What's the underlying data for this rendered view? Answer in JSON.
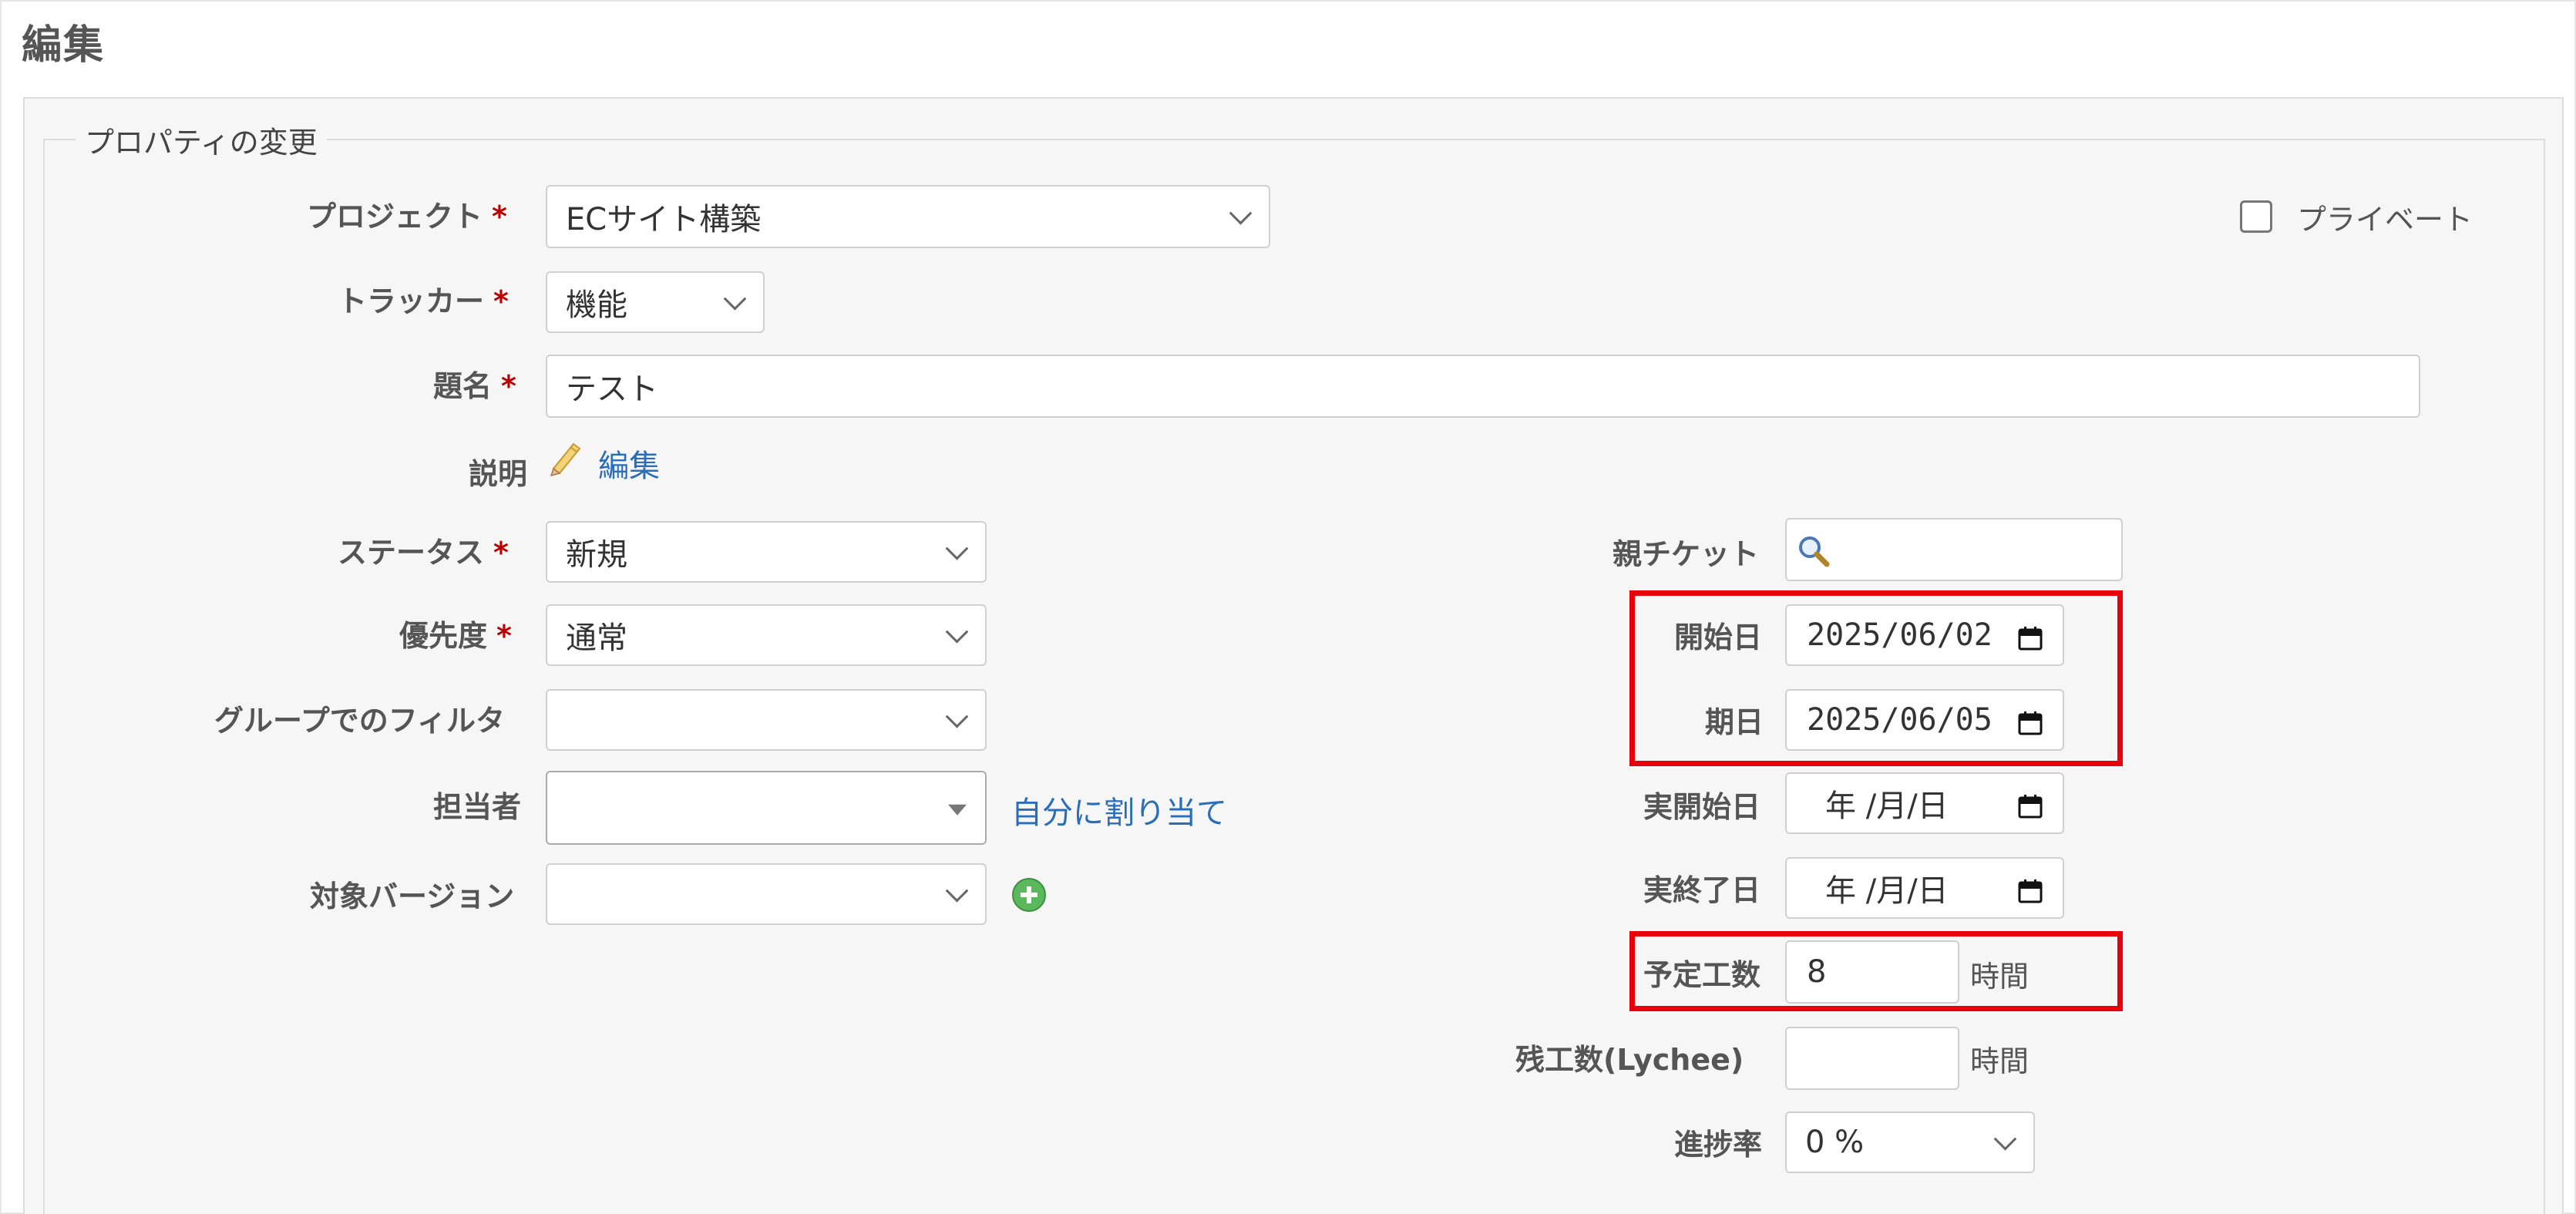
{
  "page": {
    "title": "編集"
  },
  "properties": {
    "legend": "プロパティの変更",
    "project": {
      "label": "プロジェクト",
      "required": "*",
      "value": "ECサイト構築"
    },
    "private": {
      "label": "プライベート",
      "checked": false
    },
    "tracker": {
      "label": "トラッカー",
      "required": "*",
      "value": "機能"
    },
    "subject": {
      "label": "題名",
      "required": "*",
      "value": "テスト"
    },
    "description": {
      "label": "説明",
      "edit_link": "編集"
    },
    "status": {
      "label": "ステータス",
      "required": "*",
      "value": "新規"
    },
    "priority": {
      "label": "優先度",
      "required": "*",
      "value": "通常"
    },
    "group_filter": {
      "label": "グループでのフィルタ",
      "value": ""
    },
    "assignee": {
      "label": "担当者",
      "value": "",
      "assign_to_me": "自分に割り当て"
    },
    "target_version": {
      "label": "対象バージョン",
      "value": ""
    },
    "parent_ticket": {
      "label": "親チケット",
      "value": ""
    },
    "start_date": {
      "label": "開始日",
      "value": "2025/06/02"
    },
    "due_date": {
      "label": "期日",
      "value": "2025/06/05"
    },
    "actual_start_date": {
      "label": "実開始日",
      "value": "年 /月/日"
    },
    "actual_end_date": {
      "label": "実終了日",
      "value": "年 /月/日"
    },
    "estimated_hours": {
      "label": "予定工数",
      "value": "8",
      "unit": "時間"
    },
    "remaining_hours": {
      "label": "残工数(Lychee)",
      "value": "",
      "unit": "時間"
    },
    "done_ratio": {
      "label": "進捗率",
      "value": "0 %"
    }
  },
  "colors": {
    "highlight": "#e8000b",
    "link": "#2a6ebb",
    "required": "#bb0000",
    "add_icon": "#5cb85c"
  }
}
